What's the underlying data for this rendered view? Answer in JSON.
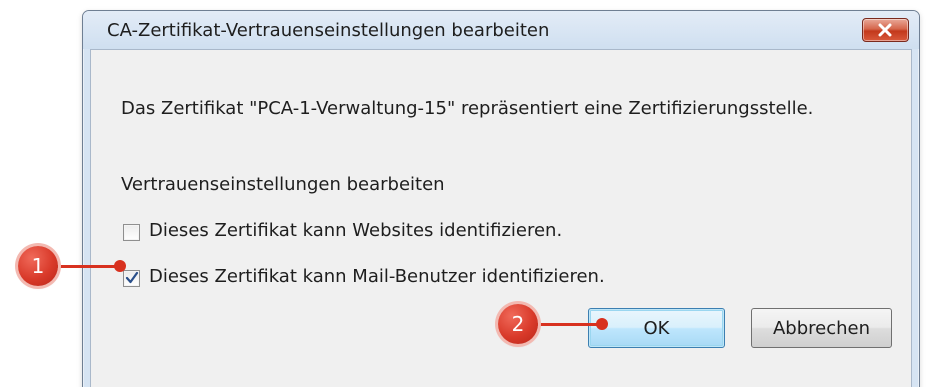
{
  "dialog": {
    "title": "CA-Zertifikat-Vertrauenseinstellungen bearbeiten",
    "message": "Das Zertifikat \"PCA-1-Verwaltung-15\" repräsentiert eine Zertifizierungsstelle.",
    "section_label": "Vertrauenseinstellungen bearbeiten",
    "checkboxes": [
      {
        "label": "Dieses Zertifikat kann Websites identifizieren.",
        "checked": false
      },
      {
        "label": "Dieses Zertifikat kann Mail-Benutzer identifizieren.",
        "checked": true
      }
    ],
    "buttons": {
      "ok_label": "OK",
      "cancel_label": "Abbrechen"
    }
  },
  "callouts": [
    {
      "number": "1",
      "target": "mail-users-checkbox"
    },
    {
      "number": "2",
      "target": "ok-button"
    }
  ],
  "colors": {
    "callout": "#d8311f",
    "titlebar": "#d6e4f3",
    "close_button": "#c3391c",
    "default_button_border": "#3c7fb1"
  },
  "icons": {
    "close": "close-icon",
    "check": "checkmark-icon"
  }
}
